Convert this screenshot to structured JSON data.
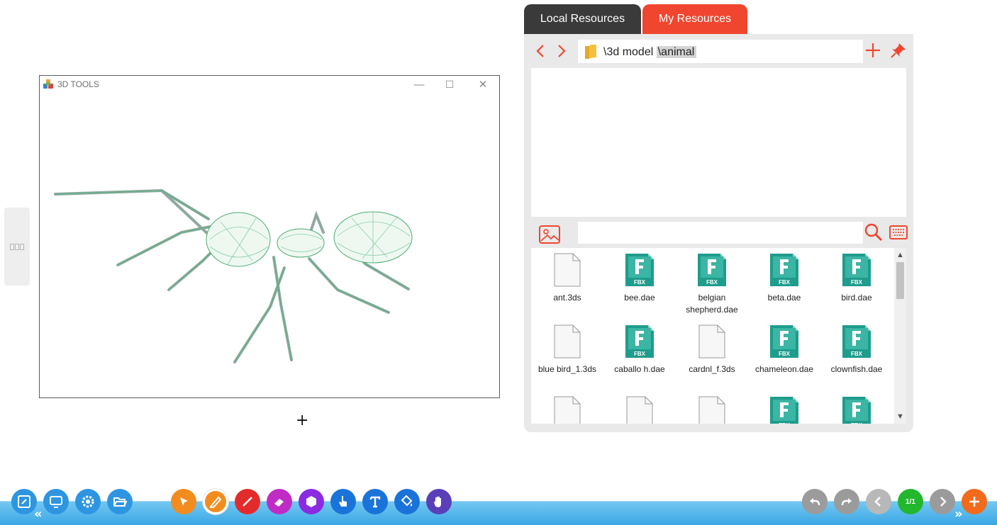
{
  "window": {
    "title": "3D TOOLS",
    "minimize": "—",
    "maximize": "☐",
    "close": "✕"
  },
  "crosshair": "+",
  "resources": {
    "tabs": [
      {
        "label": "Local Resources",
        "active": false
      },
      {
        "label": "My Resources",
        "active": true
      }
    ],
    "path": {
      "folder": "\\3d model",
      "current": "\\animal"
    },
    "search": {
      "value": "",
      "placeholder": ""
    },
    "files": [
      {
        "name": "ant.3ds",
        "type": "3ds"
      },
      {
        "name": "bee.dae",
        "type": "fbx"
      },
      {
        "name": "belgian shepherd.dae",
        "type": "fbx"
      },
      {
        "name": "beta.dae",
        "type": "fbx"
      },
      {
        "name": "bird.dae",
        "type": "fbx"
      },
      {
        "name": "blue bird_1.3ds",
        "type": "3ds"
      },
      {
        "name": "caballo h.dae",
        "type": "fbx"
      },
      {
        "name": "cardnl_f.3ds",
        "type": "3ds"
      },
      {
        "name": "chameleon.dae",
        "type": "fbx"
      },
      {
        "name": "clownfish.dae",
        "type": "fbx"
      },
      {
        "name": "",
        "type": "3ds"
      },
      {
        "name": "",
        "type": "3ds"
      },
      {
        "name": "",
        "type": "3ds"
      },
      {
        "name": "",
        "type": "fbx"
      },
      {
        "name": "",
        "type": "fbx"
      }
    ],
    "fbx_icon_label": "FBX"
  },
  "toolbar": {
    "page_indicator": "1/1",
    "collapse_left": "«",
    "collapse_right": "»"
  },
  "colors": {
    "accent_red": "#f0462f",
    "tab_dark": "#3a3a3a",
    "file_teal": "#1e9c8c",
    "toolbar_blue": "#3aa7e4"
  }
}
